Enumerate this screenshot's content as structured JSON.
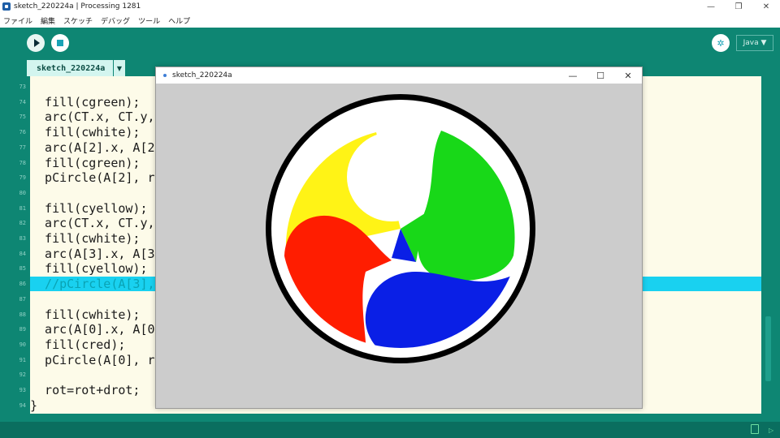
{
  "window": {
    "title": "sketch_220224a | Processing 1281",
    "controls": [
      "—",
      "❐",
      "✕"
    ]
  },
  "menu": [
    "ファイル",
    "編集",
    "スケッチ",
    "デバッグ",
    "ツール",
    "ヘルプ"
  ],
  "toolbar": {
    "debug_icon": "butterfly-icon",
    "mode_label": "Java ▼"
  },
  "tabs": {
    "active": "sketch_220224a",
    "arrow": "▼"
  },
  "editor": {
    "line_numbers": [
      "73",
      "74",
      "75",
      "76",
      "77",
      "78",
      "79",
      "80",
      "81",
      "82",
      "83",
      "84",
      "85",
      "86",
      "87",
      "88",
      "89",
      "90",
      "91",
      "92",
      "93",
      "94"
    ],
    "lines": [
      "",
      "  fill(cgreen);",
      "  arc(CT.x, CT.y,",
      "  fill(cwhite);",
      "  arc(A[2].x, A[2",
      "  fill(cgreen);",
      "  pCircle(A[2], r",
      "",
      "  fill(cyellow);",
      "  arc(CT.x, CT.y,",
      "  fill(cwhite);",
      "  arc(A[3].x, A[3",
      "  fill(cyellow);",
      "  //pCircle(A[3],",
      "",
      "  fill(cwhite);",
      "  arc(A[0].x, A[0",
      "  fill(cred);",
      "  pCircle(A[0], r",
      "",
      "  rot=rot+drot;",
      "}"
    ],
    "highlighted_line_index": 13
  },
  "sketch_window": {
    "title": "sketch_220224a",
    "controls": [
      "—",
      "☐",
      "✕"
    ]
  },
  "colors": {
    "yellow": "#fff316",
    "green": "#18d818",
    "red": "#ff1d00",
    "blue": "#0a1fe6",
    "white": "#ffffff",
    "black": "#000000",
    "canvas_bg": "#cccccc"
  }
}
